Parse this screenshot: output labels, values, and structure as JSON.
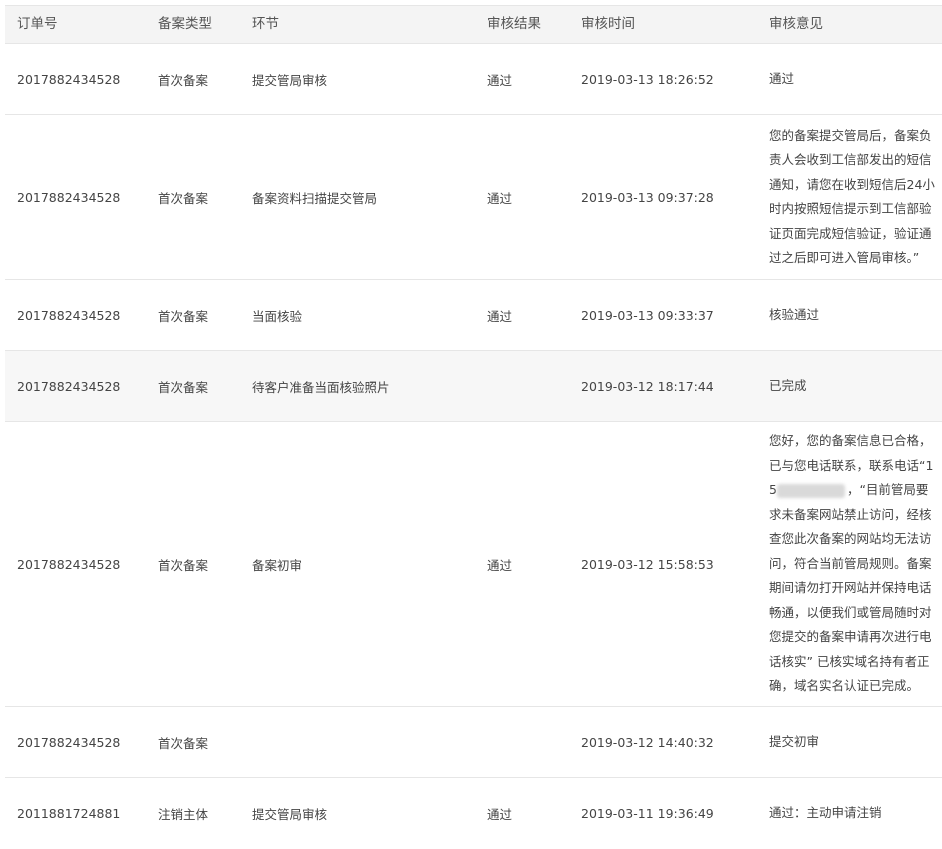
{
  "headers": {
    "order_no": "订单号",
    "filing_type": "备案类型",
    "stage": "环节",
    "result": "审核结果",
    "time": "审核时间",
    "opinion": "审核意见"
  },
  "rows": [
    {
      "order_no": "2017882434528",
      "filing_type": "首次备案",
      "stage": "提交管局审核",
      "result": "通过",
      "time": "2019-03-13 18:26:52",
      "opinion": "通过"
    },
    {
      "order_no": "2017882434528",
      "filing_type": "首次备案",
      "stage": "备案资料扫描提交管局",
      "result": "通过",
      "time": "2019-03-13 09:37:28",
      "opinion": "您的备案提交管局后，备案负责人会收到工信部发出的短信通知，请您在收到短信后24小时内按照短信提示到工信部验证页面完成短信验证，验证通过之后即可进入管局审核。”"
    },
    {
      "order_no": "2017882434528",
      "filing_type": "首次备案",
      "stage": "当面核验",
      "result": "通过",
      "time": "2019-03-13 09:33:37",
      "opinion": "核验通过"
    },
    {
      "order_no": "2017882434528",
      "filing_type": "首次备案",
      "stage": "待客户准备当面核验照片",
      "result": "",
      "time": "2019-03-12 18:17:44",
      "opinion": "已完成"
    },
    {
      "order_no": "2017882434528",
      "filing_type": "首次备案",
      "stage": "备案初审",
      "result": "通过",
      "time": "2019-03-12 15:58:53",
      "opinion_before_mask": "您好，您的备案信息已合格，已与您电话联系，联系电话“15",
      "opinion_after_mask": "，“目前管局要求未备案网站禁止访问，经核查您此次备案的网站均无法访问，符合当前管局规则。备案期间请勿打开网站并保持电话畅通，以便我们或管局随时对您提交的备案申请再次进行电话核实” 已核实域名持有者正确，域名实名认证已完成。"
    },
    {
      "order_no": "2017882434528",
      "filing_type": "首次备案",
      "stage": "",
      "result": "",
      "time": "2019-03-12 14:40:32",
      "opinion": "提交初审"
    },
    {
      "order_no": "2011881724881",
      "filing_type": "注销主体",
      "stage": "提交管局审核",
      "result": "通过",
      "time": "2019-03-11 19:36:49",
      "opinion": "通过：主动申请注销"
    }
  ]
}
